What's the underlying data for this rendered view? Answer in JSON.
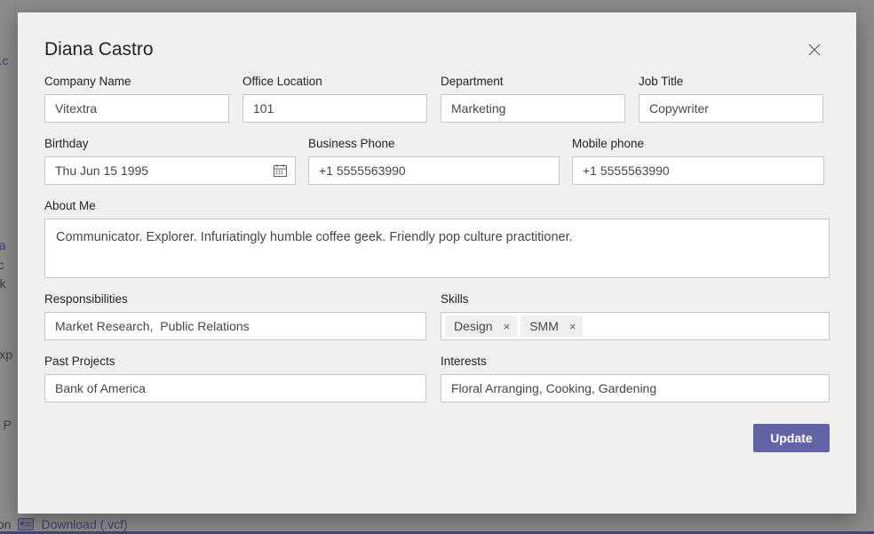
{
  "background": {
    "email_fragment": "ra.c",
    "link_fragment": "cha",
    "line_fragments": [
      "irec",
      "lark"
    ],
    "fragment_exp": "Exp",
    "fragment_pr": "n, P",
    "footer_info": "ormation",
    "footer_download": "Download (.vcf)",
    "accent": "#5b5fc7"
  },
  "dialog": {
    "title": "Diana Castro",
    "close_icon": "close-icon",
    "accent_color": "#6264a7",
    "fields": {
      "company_name": {
        "label": "Company Name",
        "value": "Vitextra"
      },
      "office_location": {
        "label": "Office Location",
        "value": "101"
      },
      "department": {
        "label": "Department",
        "value": "Marketing"
      },
      "job_title": {
        "label": "Job Title",
        "value": "Copywriter"
      },
      "birthday": {
        "label": "Birthday",
        "value": "Thu Jun 15 1995",
        "icon": "calendar-icon"
      },
      "business_phone": {
        "label": "Business Phone",
        "value": "+1 5555563990"
      },
      "mobile_phone": {
        "label": "Mobile phone",
        "value": "+1 5555563990"
      },
      "about_me": {
        "label": "About Me",
        "value": "Communicator. Explorer. Infuriatingly humble coffee geek. Friendly pop culture practitioner."
      },
      "responsibilities": {
        "label": "Responsibilities",
        "value": "Market Research,  Public Relations"
      },
      "skills": {
        "label": "Skills",
        "chips": [
          {
            "text": "Design",
            "remove_icon": "×"
          },
          {
            "text": "SMM",
            "remove_icon": "×"
          }
        ]
      },
      "past_projects": {
        "label": "Past Projects",
        "value": "Bank of America"
      },
      "interests": {
        "label": "Interests",
        "value": "Floral Arranging, Cooking, Gardening"
      }
    },
    "submit_label": "Update"
  }
}
